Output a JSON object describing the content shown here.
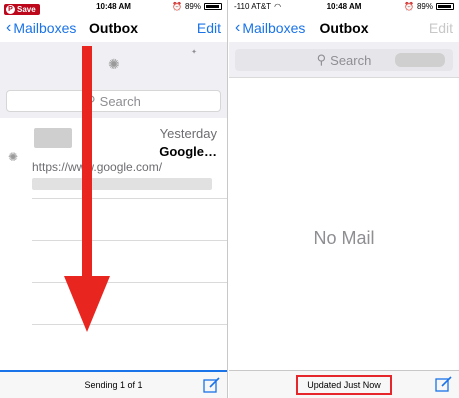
{
  "left": {
    "status": {
      "time": "10:48 AM",
      "battery": "89%"
    },
    "nav": {
      "back": "Mailboxes",
      "title": "Outbox",
      "edit": "Edit"
    },
    "search_placeholder": "Search",
    "message": {
      "date": "Yesterday",
      "subject": "Google…",
      "preview": "https://www.google.com/"
    },
    "toolbar_status": "Sending 1 of 1"
  },
  "right": {
    "status": {
      "carrier": "-110 AT&T",
      "time": "10:48 AM",
      "battery": "89%"
    },
    "nav": {
      "back": "Mailboxes",
      "title": "Outbox",
      "edit": "Edit"
    },
    "search_placeholder": "Search",
    "empty_text": "No Mail",
    "toolbar_status": "Updated Just Now"
  },
  "save_badge": "Save",
  "colors": {
    "ios_blue": "#1a73e8",
    "highlight_red": "#e5262b",
    "arrow_red": "#e8251f",
    "pinterest_red": "#bd081c"
  },
  "icons": [
    "back-chevron-icon",
    "search-icon",
    "spinner-icon",
    "compose-icon",
    "wifi-icon",
    "battery-icon",
    "pinterest-icon",
    "down-arrow-icon"
  ]
}
